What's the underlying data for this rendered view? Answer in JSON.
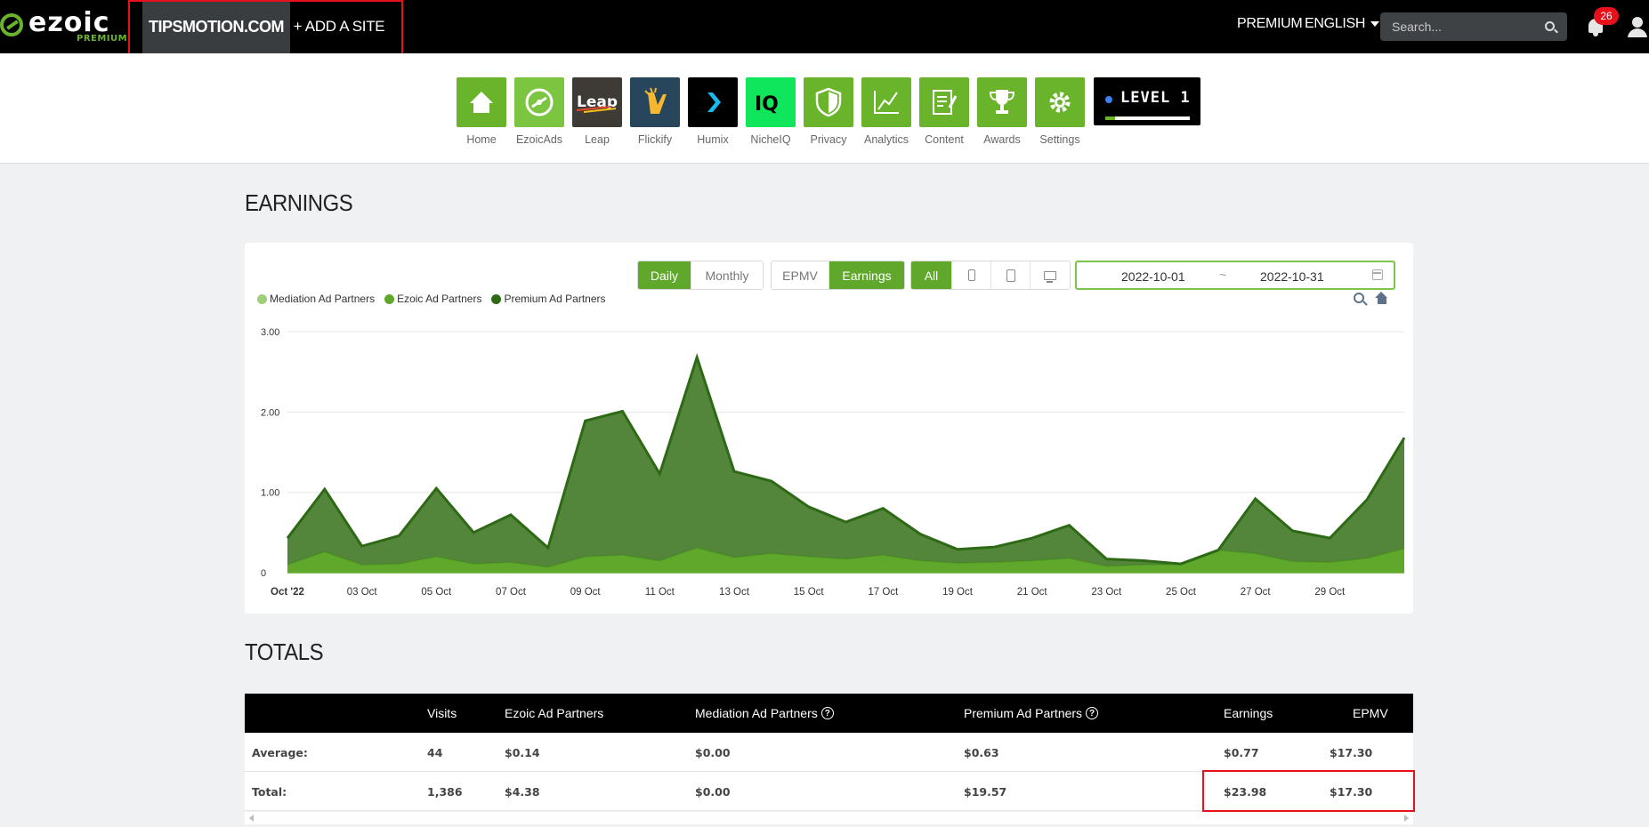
{
  "brand": {
    "logo": "ezoic",
    "sub": "PREMIUM",
    "accent": "#6ab42c"
  },
  "topbar": {
    "site": "TIPSMOTION.COM",
    "add_site": "+ ADD A SITE",
    "premium": "PREMIUM",
    "language": "ENGLISH",
    "search_placeholder": "Search...",
    "notifications": "26"
  },
  "apps": [
    {
      "label": "Home",
      "icon": "home-icon",
      "color": "#6ab42c"
    },
    {
      "label": "EzoicAds",
      "icon": "ezoicads-icon",
      "color": "#7cc540"
    },
    {
      "label": "Leap",
      "icon": "leap-icon",
      "color": "#3e3a36"
    },
    {
      "label": "Flickify",
      "icon": "flickify-icon",
      "color": "#27465c"
    },
    {
      "label": "Humix",
      "icon": "humix-icon",
      "color": "#000000"
    },
    {
      "label": "NicheIQ",
      "icon": "nicheiq-icon",
      "color": "#10e65c"
    },
    {
      "label": "Privacy",
      "icon": "shield-icon",
      "color": "#6ab42c"
    },
    {
      "label": "Analytics",
      "icon": "analytics-icon",
      "color": "#6ab42c"
    },
    {
      "label": "Content",
      "icon": "content-icon",
      "color": "#6ab42c"
    },
    {
      "label": "Awards",
      "icon": "trophy-icon",
      "color": "#6ab42c"
    },
    {
      "label": "Settings",
      "icon": "gear-icon",
      "color": "#6ab42c"
    }
  ],
  "level": {
    "label": "LEVEL 1",
    "progress": 0.12
  },
  "earnings_title": "EARNINGS",
  "controls": {
    "period": [
      "Daily",
      "Monthly"
    ],
    "metric": [
      "EPMV",
      "Earnings"
    ],
    "device": [
      "All"
    ],
    "date_start": "2022-10-01",
    "date_sep": "~",
    "date_end": "2022-10-31"
  },
  "chart_data": {
    "type": "area",
    "stacked": true,
    "x": [
      "Oct '22",
      "02 Oct",
      "03 Oct",
      "04 Oct",
      "05 Oct",
      "06 Oct",
      "07 Oct",
      "08 Oct",
      "09 Oct",
      "10 Oct",
      "11 Oct",
      "12 Oct",
      "13 Oct",
      "14 Oct",
      "15 Oct",
      "16 Oct",
      "17 Oct",
      "18 Oct",
      "19 Oct",
      "20 Oct",
      "21 Oct",
      "22 Oct",
      "23 Oct",
      "24 Oct",
      "25 Oct",
      "26 Oct",
      "27 Oct",
      "28 Oct",
      "29 Oct",
      "30 Oct",
      "31 Oct"
    ],
    "tick_labels": [
      "Oct '22",
      "03 Oct",
      "05 Oct",
      "07 Oct",
      "09 Oct",
      "11 Oct",
      "13 Oct",
      "15 Oct",
      "17 Oct",
      "19 Oct",
      "21 Oct",
      "23 Oct",
      "25 Oct",
      "27 Oct",
      "29 Oct"
    ],
    "y_ticks": [
      "0",
      "1.00",
      "2.00",
      "3.00"
    ],
    "ylim": [
      0,
      3
    ],
    "series": [
      {
        "name": "Mediation Ad Partners",
        "color": "#9ccf78",
        "values": [
          0,
          0,
          0,
          0,
          0,
          0,
          0,
          0,
          0,
          0,
          0,
          0,
          0,
          0,
          0,
          0,
          0,
          0,
          0,
          0,
          0,
          0,
          0,
          0,
          0,
          0,
          0,
          0,
          0,
          0,
          0
        ]
      },
      {
        "name": "Ezoic Ad Partners",
        "color": "#5fa82c",
        "values": [
          0.1,
          0.26,
          0.1,
          0.11,
          0.2,
          0.11,
          0.13,
          0.07,
          0.2,
          0.22,
          0.15,
          0.31,
          0.19,
          0.24,
          0.2,
          0.17,
          0.22,
          0.15,
          0.12,
          0.13,
          0.15,
          0.18,
          0.08,
          0.1,
          0.1,
          0.28,
          0.24,
          0.14,
          0.13,
          0.18,
          0.3
        ]
      },
      {
        "name": "Premium Ad Partners",
        "color": "#3b7422",
        "values": [
          0.33,
          0.78,
          0.23,
          0.35,
          0.85,
          0.39,
          0.59,
          0.24,
          1.69,
          1.79,
          1.08,
          2.37,
          1.07,
          0.9,
          0.62,
          0.46,
          0.58,
          0.33,
          0.17,
          0.19,
          0.28,
          0.41,
          0.09,
          0.05,
          0.01,
          0.0,
          0.68,
          0.38,
          0.3,
          0.73,
          1.38
        ]
      }
    ]
  },
  "totals_title": "TOTALS",
  "table": {
    "columns": [
      "",
      "Visits",
      "Ezoic Ad Partners",
      "Mediation Ad Partners",
      "Premium Ad Partners",
      "Earnings",
      "EPMV"
    ],
    "rows": [
      [
        "Average:",
        "44",
        "$0.14",
        "$0.00",
        "$0.63",
        "$0.77",
        "$17.30"
      ],
      [
        "Total:",
        "1,386",
        "$4.38",
        "$0.00",
        "$19.57",
        "$23.98",
        "$17.30"
      ]
    ]
  }
}
